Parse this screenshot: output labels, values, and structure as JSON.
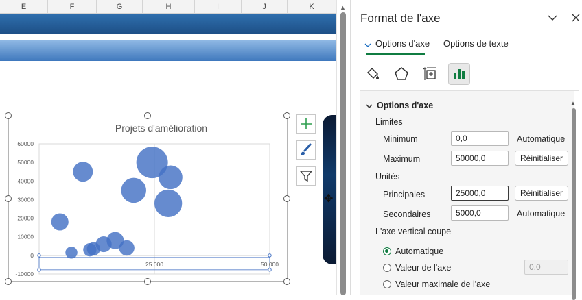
{
  "sheet": {
    "columns": [
      "E",
      "F",
      "G",
      "H",
      "I",
      "J",
      "K"
    ]
  },
  "chart_data": {
    "type": "bubble",
    "title": "Projets d'amélioration",
    "y_ticks": [
      "60000",
      "50000",
      "40000",
      "30000",
      "20000",
      "10000",
      "0",
      "-10000"
    ],
    "x_ticks": [
      "25 000",
      "50 000"
    ],
    "ylim": [
      -10000,
      60000
    ],
    "xlim": [
      0,
      50000
    ],
    "bubble_color": "#4472c4",
    "points": [
      {
        "x": 4500,
        "y": 18000,
        "size": 0.45
      },
      {
        "x": 7000,
        "y": 1500,
        "size": 0.25
      },
      {
        "x": 9500,
        "y": 45000,
        "size": 0.55
      },
      {
        "x": 11000,
        "y": 3000,
        "size": 0.3
      },
      {
        "x": 11800,
        "y": 3500,
        "size": 0.3
      },
      {
        "x": 14000,
        "y": 6000,
        "size": 0.4
      },
      {
        "x": 16500,
        "y": 8000,
        "size": 0.45
      },
      {
        "x": 19000,
        "y": 4000,
        "size": 0.38
      },
      {
        "x": 20500,
        "y": 35000,
        "size": 0.75
      },
      {
        "x": 24500,
        "y": 50000,
        "size": 1.0
      },
      {
        "x": 28000,
        "y": 28000,
        "size": 0.85
      },
      {
        "x": 28500,
        "y": 42000,
        "size": 0.7
      }
    ]
  },
  "pane": {
    "title": "Format de l'axe",
    "tabs": {
      "axis": "Options d'axe",
      "text": "Options de texte"
    },
    "section": "Options d'axe",
    "limits": {
      "heading": "Limites",
      "min_label": "Minimum",
      "min_value": "0,0",
      "min_state": "Automatique",
      "max_label": "Maximum",
      "max_value": "50000,0",
      "max_button": "Réinitialiser"
    },
    "units": {
      "heading": "Unités",
      "major_label": "Principales",
      "major_value": "25000,0",
      "major_button": "Réinitialiser",
      "minor_label": "Secondaires",
      "minor_value": "5000,0",
      "minor_state": "Automatique"
    },
    "crosses": {
      "heading": "L'axe vertical coupe",
      "auto": "Automatique",
      "value": "Valeur de l'axe",
      "value_field": "0,0",
      "max": "Valeur maximale de l'axe"
    }
  }
}
